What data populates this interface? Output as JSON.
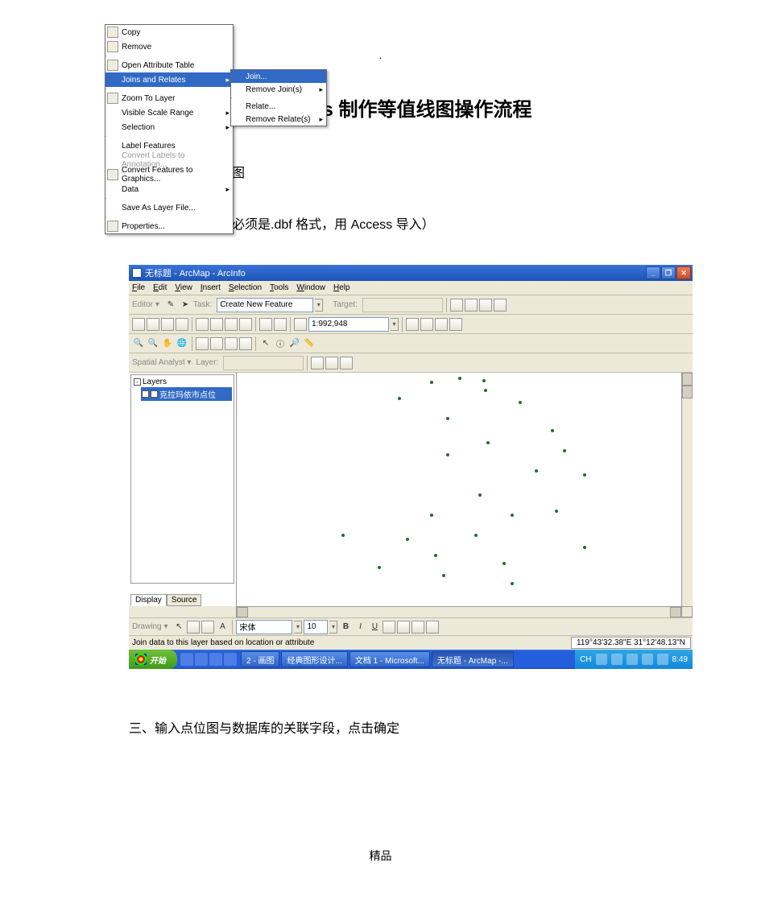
{
  "doc": {
    "dot": ".",
    "title": "利用 Arcgis 制作等值线图操作流程",
    "step1": "一、打开监测点位图",
    "step2": "二、关联数据库（必须是.dbf 格式，用 Access 导入）",
    "step3": "三、输入点位图与数据库的关联字段，点击确定",
    "footer": "精品"
  },
  "win": {
    "title": "无标题 - ArcMap - ArcInfo",
    "menus": [
      "File",
      "Edit",
      "View",
      "Insert",
      "Selection",
      "Tools",
      "Window",
      "Help"
    ],
    "editor_label": "Editor ▾",
    "task_label": "Task:",
    "task_value": "Create New Feature",
    "target_label": "Target:",
    "scale": "1:992,948",
    "spatial_label": "Spatial Analyst ▾",
    "layer_label": "Layer:",
    "layers_root": "Layers",
    "layers_item": "克拉玛依市点位",
    "toc_tabs": {
      "display": "Display",
      "source": "Source"
    },
    "ctx": {
      "copy": "Copy",
      "remove": "Remove",
      "open_table": "Open Attribute Table",
      "joins": "Joins and Relates",
      "zoom": "Zoom To Layer",
      "scale_range": "Visible Scale Range",
      "selection": "Selection",
      "label_feat": "Label Features",
      "convert_anno": "Convert Labels to Annotation...",
      "convert_gfx": "Convert Features to Graphics...",
      "data": "Data",
      "save_layer": "Save As Layer File...",
      "properties": "Properties..."
    },
    "sub": {
      "join": "Join...",
      "remove_joins": "Remove Join(s)",
      "relate": "Relate...",
      "remove_relates": "Remove Relate(s)"
    },
    "draw_label": "Drawing ▾",
    "font_value": "宋体",
    "size_value": "10",
    "status": "Join data to this layer based on location or attribute",
    "coords": "119°43'32.38\"E  31°12'48.13\"N"
  },
  "taskbar": {
    "start": "开始",
    "tasks": [
      "2 - 画图",
      "经典图形设计...",
      "文档 1 - Microsoft...",
      "无标题 - ArcMap -..."
    ],
    "lang": "CH",
    "time": "8:49"
  }
}
